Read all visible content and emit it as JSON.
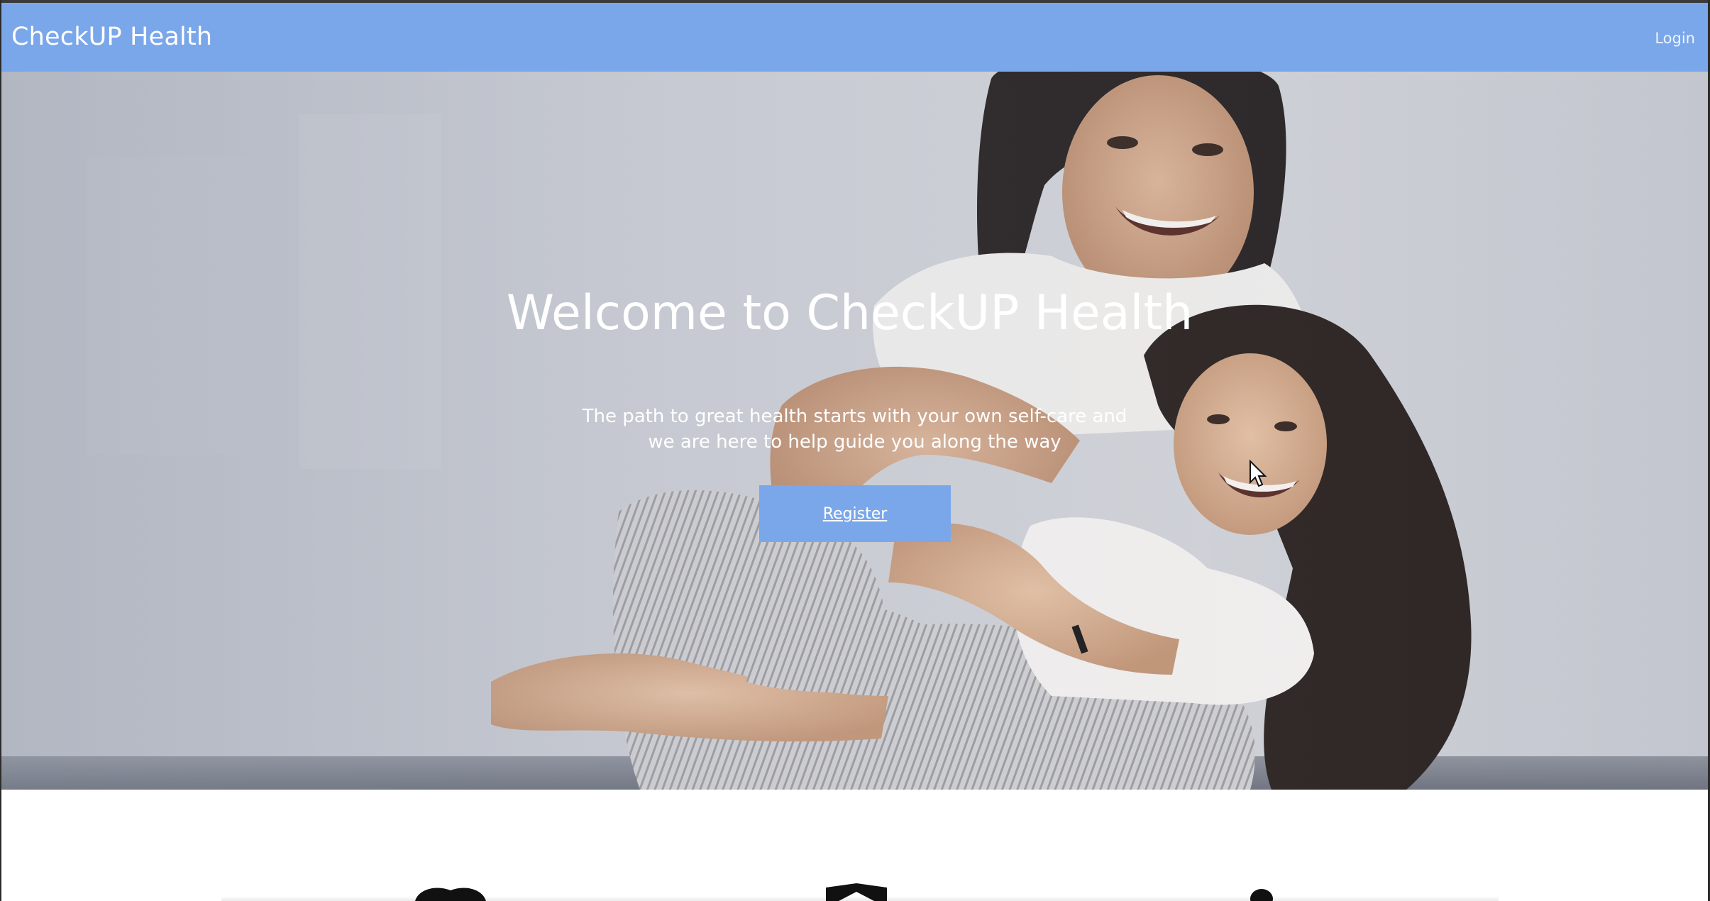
{
  "navbar": {
    "brand": "CheckUP Health",
    "login_label": "Login"
  },
  "hero": {
    "title": "Welcome to CheckUP Health",
    "subtitle_line1": "The path to great health starts with your own self-care and",
    "subtitle_line2": "we are here to help guide you along the way",
    "register_label": "Register",
    "image_description_icon": "family-photo"
  },
  "features": {
    "icons": [
      "book-icon",
      "envelope-icon",
      "person-icon"
    ]
  },
  "colors": {
    "accent": "#7aa7ea",
    "hero_text": "#ffffff",
    "page_background": "#ffffff"
  }
}
